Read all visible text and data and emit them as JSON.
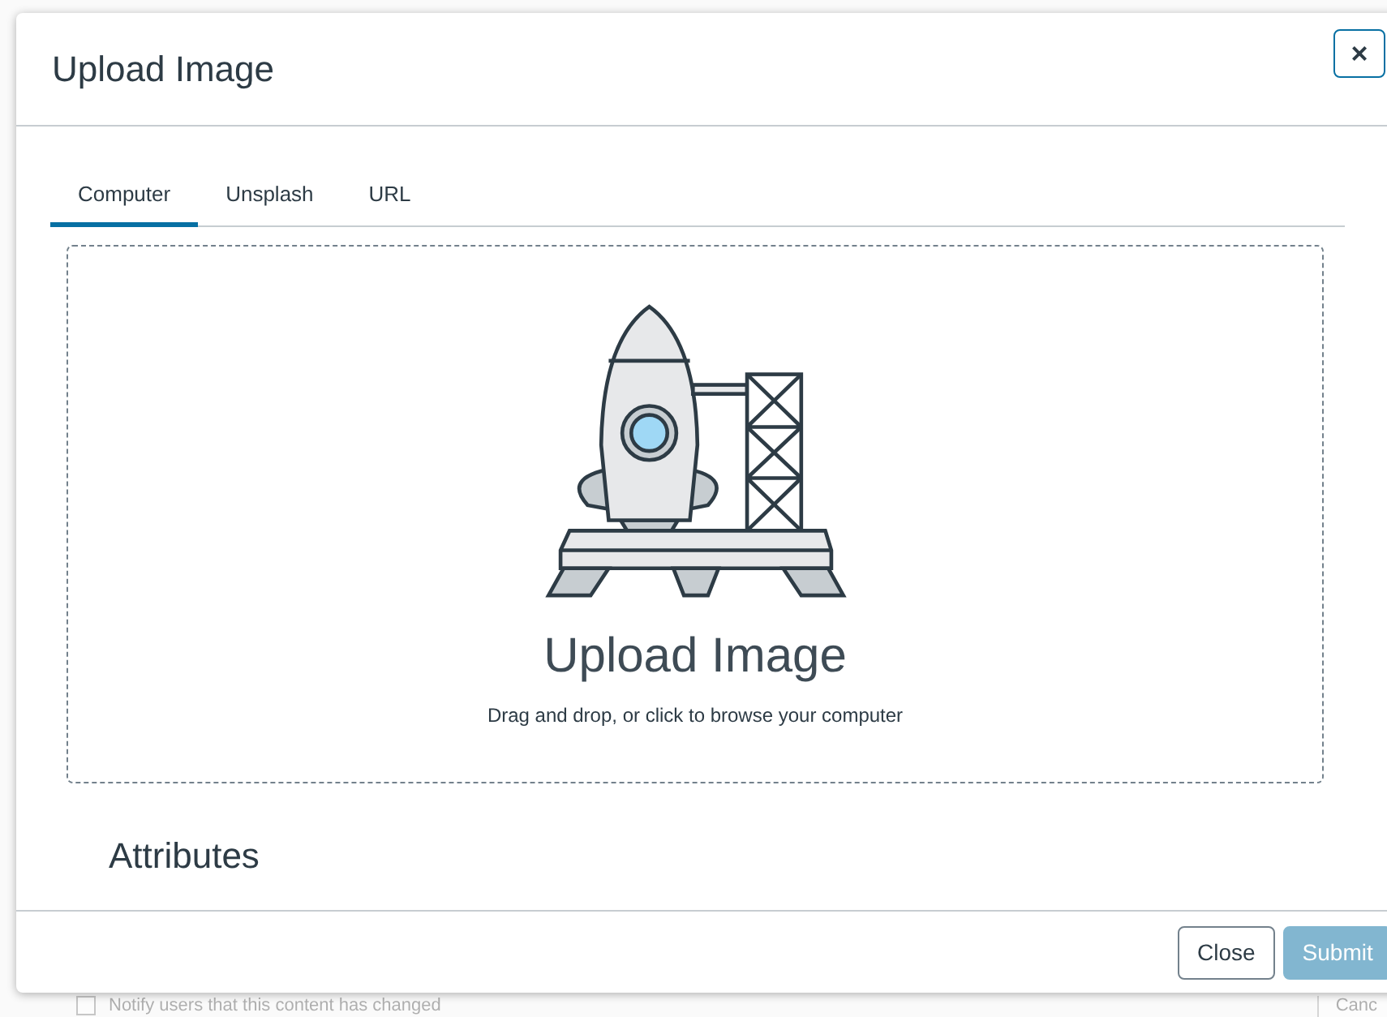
{
  "dialog": {
    "title": "Upload Image",
    "close_glyph": "×"
  },
  "tabs": [
    {
      "label": "Computer",
      "selected": true
    },
    {
      "label": "Unsplash",
      "selected": false
    },
    {
      "label": "URL",
      "selected": false
    }
  ],
  "dropzone": {
    "heading": "Upload Image",
    "hint": "Drag and drop, or click to browse your computer"
  },
  "section_heading": "Attributes",
  "buttons": [
    {
      "label": "Close",
      "kind": "secondary",
      "disabled": false
    },
    {
      "label": "Submit",
      "kind": "primary",
      "disabled": true
    }
  ],
  "background": {
    "checkbox_label": "Notify users that this content has changed",
    "checked": false,
    "button": "Canc"
  }
}
